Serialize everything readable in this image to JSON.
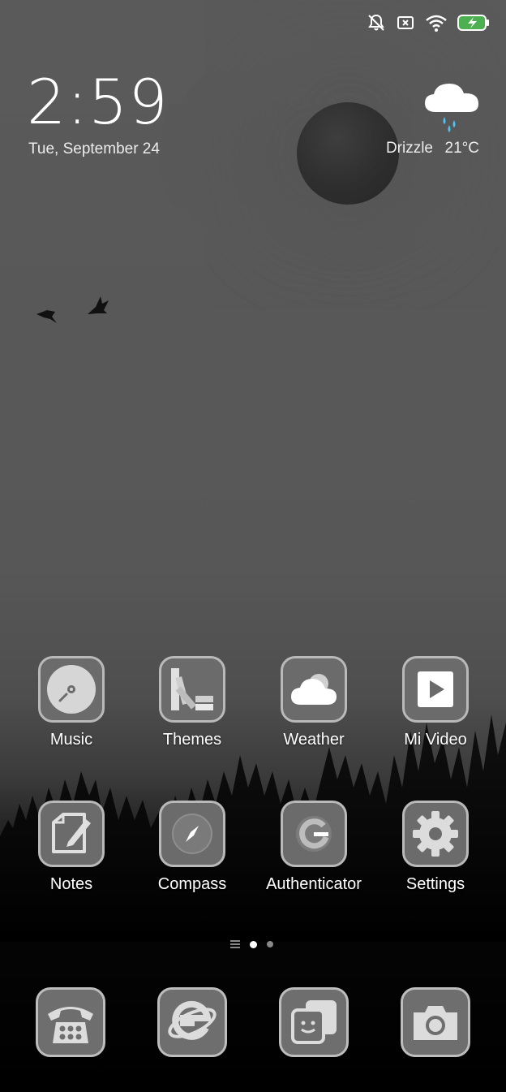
{
  "status_bar": {
    "icons": [
      "mute-vibrate-icon",
      "no-sim-icon",
      "wifi-icon",
      "battery-charging-icon"
    ],
    "battery_color": "#4caf50"
  },
  "clock": {
    "time": "2:59",
    "date": "Tue, September 24"
  },
  "weather": {
    "condition": "Drizzle",
    "temperature": "21°C",
    "icon": "cloud-rain-icon"
  },
  "apps": [
    {
      "label": "Music",
      "icon": "music-disc-icon"
    },
    {
      "label": "Themes",
      "icon": "color-palette-icon"
    },
    {
      "label": "Weather",
      "icon": "weather-cloud-icon"
    },
    {
      "label": "Mi Video",
      "icon": "play-video-icon"
    },
    {
      "label": "Notes",
      "icon": "notes-pencil-icon"
    },
    {
      "label": "Compass",
      "icon": "compass-icon"
    },
    {
      "label": "Authenticator",
      "icon": "google-g-icon"
    },
    {
      "label": "Settings",
      "icon": "gear-icon"
    }
  ],
  "page_indicator": {
    "pages": 3,
    "active_index": 1
  },
  "dock": [
    {
      "icon": "phone-icon"
    },
    {
      "icon": "browser-icon"
    },
    {
      "icon": "messages-icon"
    },
    {
      "icon": "camera-icon"
    }
  ]
}
